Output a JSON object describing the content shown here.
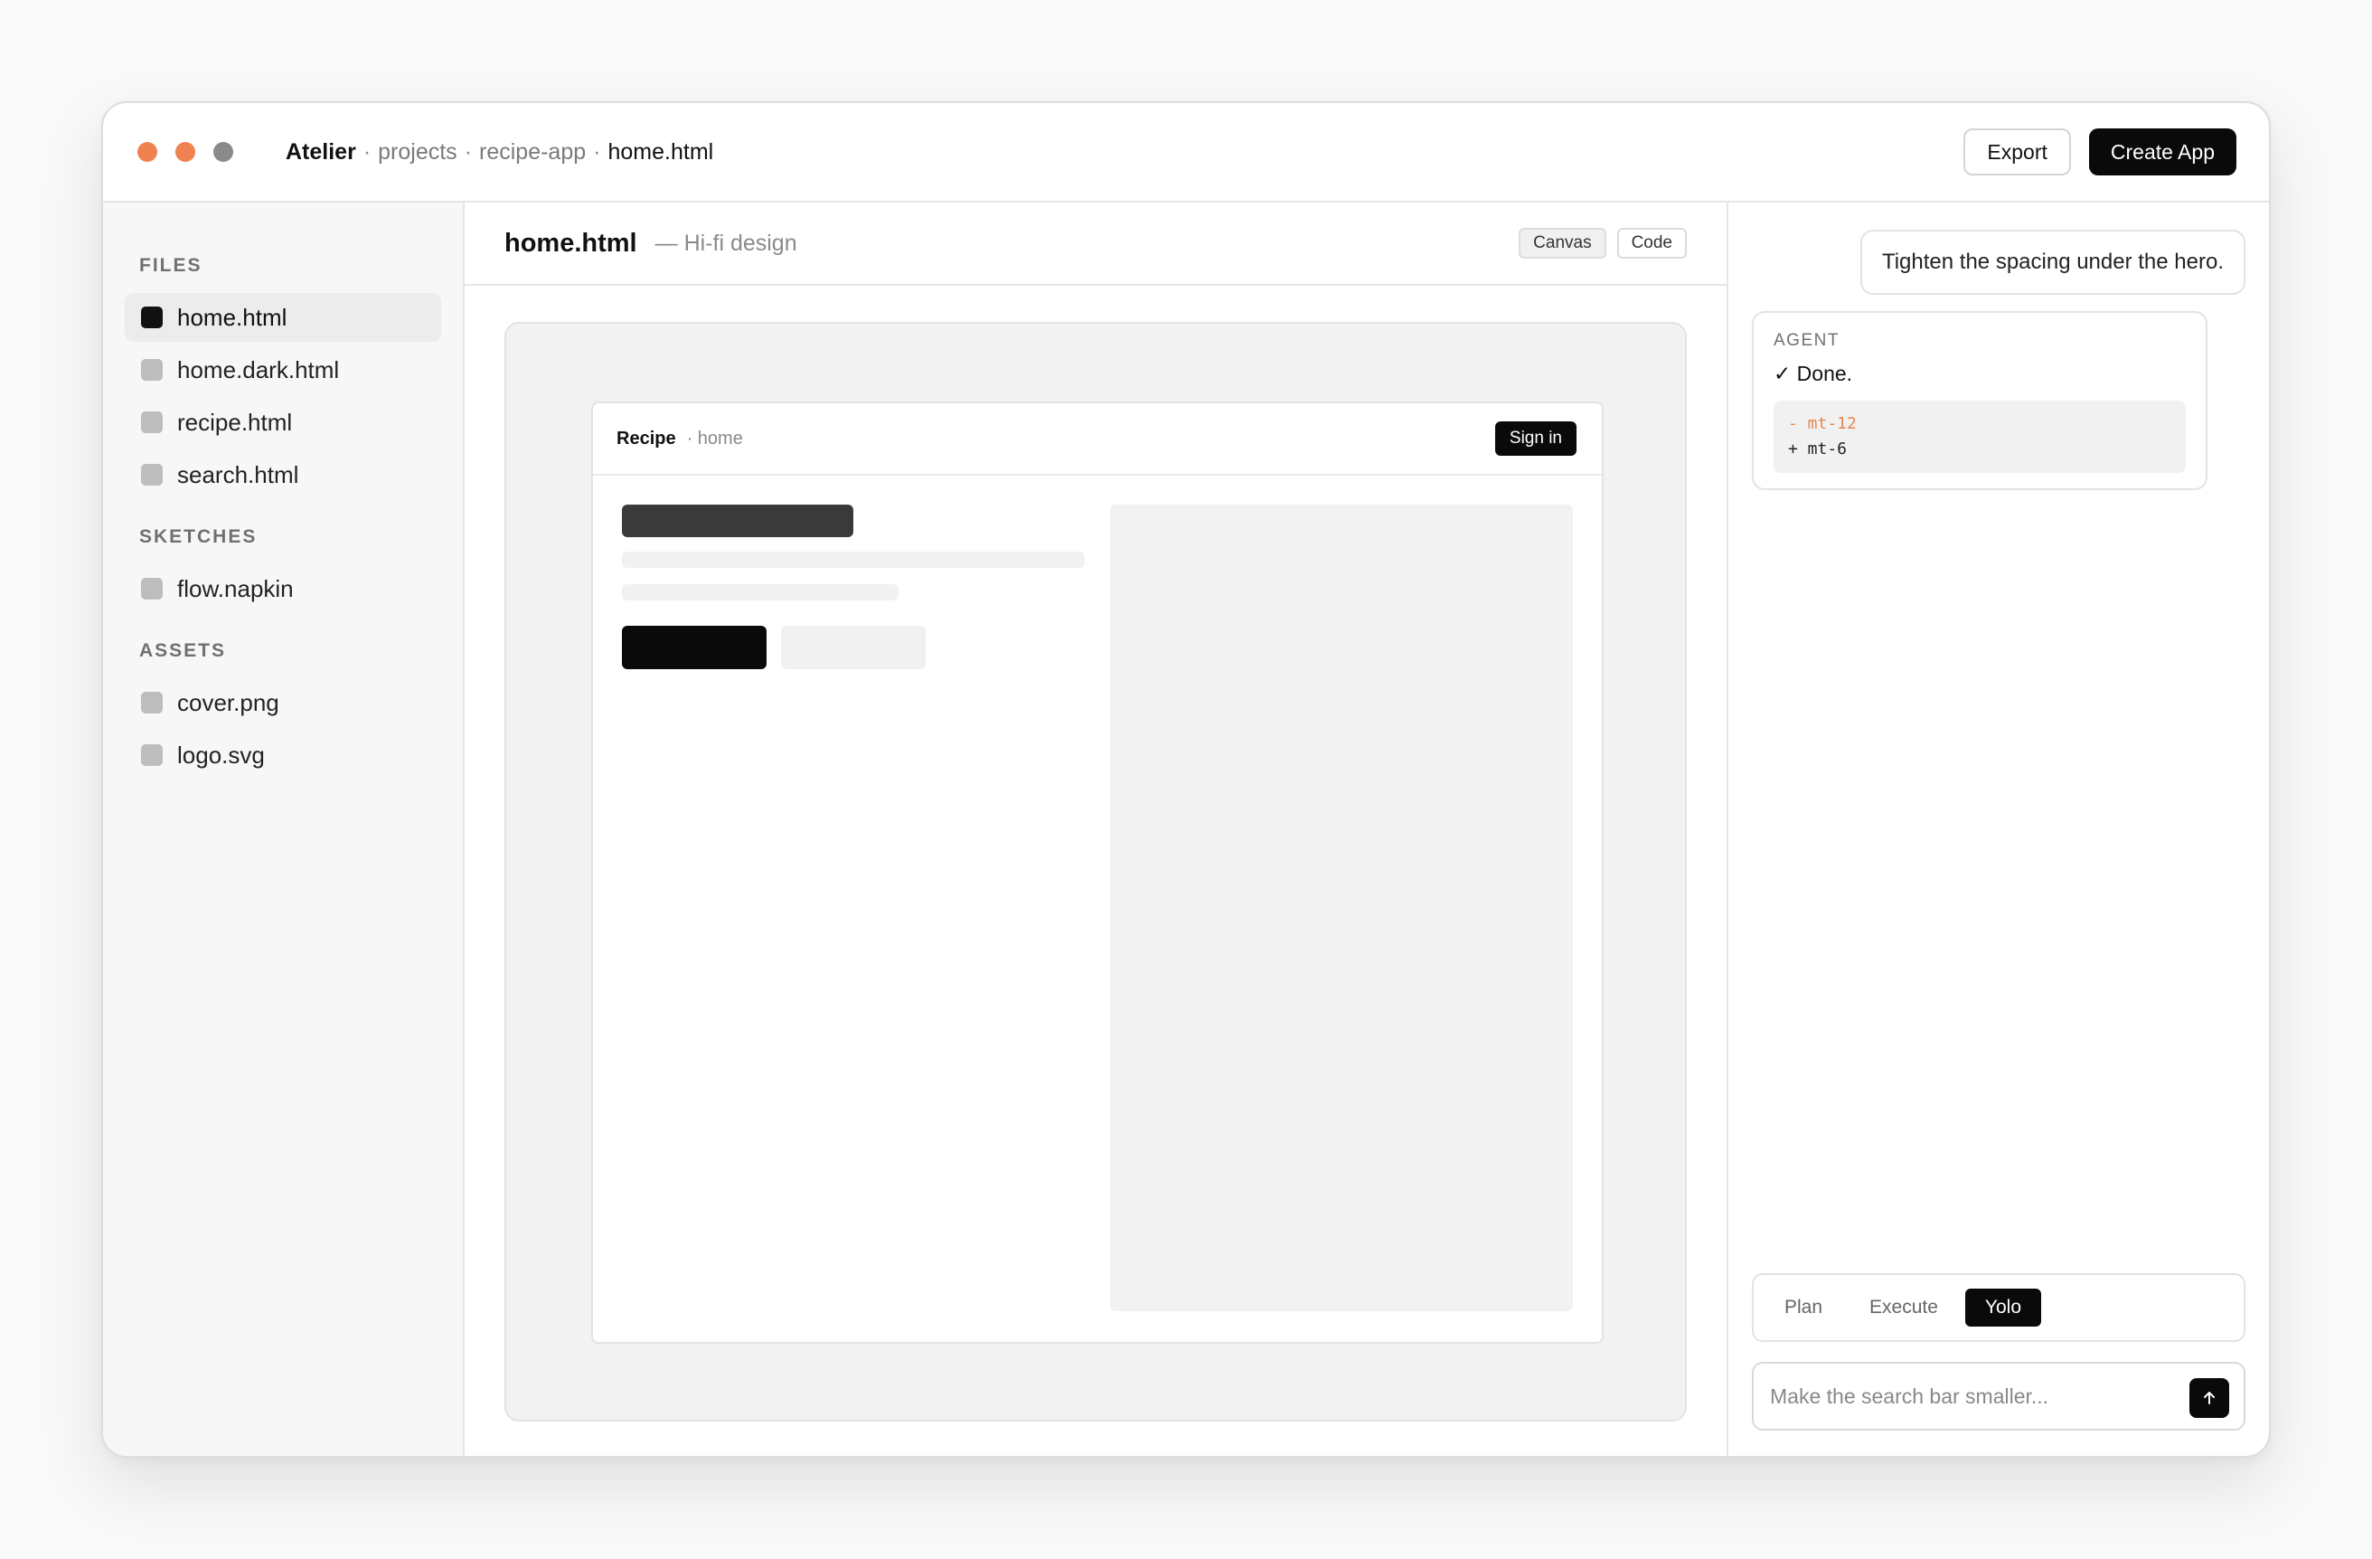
{
  "window": {
    "traffic_colors": [
      "#f0824f",
      "#f0824f",
      "#8a8a8a"
    ]
  },
  "titlebar": {
    "brand": "Atelier",
    "separator": "·",
    "crumbs": [
      "projects",
      "recipe-app"
    ],
    "current": "home.html",
    "export_label": "Export",
    "create_label": "Create App"
  },
  "sidebar": {
    "sections": [
      {
        "label": "FILES",
        "items": [
          {
            "name": "home.html",
            "active": true
          },
          {
            "name": "home.dark.html",
            "active": false
          },
          {
            "name": "recipe.html",
            "active": false
          },
          {
            "name": "search.html",
            "active": false
          }
        ]
      },
      {
        "label": "SKETCHES",
        "items": [
          {
            "name": "flow.napkin",
            "active": false
          }
        ]
      },
      {
        "label": "ASSETS",
        "items": [
          {
            "name": "cover.png",
            "active": false
          },
          {
            "name": "logo.svg",
            "active": false
          }
        ]
      }
    ]
  },
  "editor": {
    "title": "home.html",
    "subtitle": "— Hi-fi design",
    "canvas_label": "Canvas",
    "code_label": "Code",
    "preview": {
      "brand": "Recipe",
      "sub": "· home",
      "signin_label": "Sign in"
    }
  },
  "chat": {
    "user_message": "Tighten the spacing under the hero.",
    "agent_label": "AGENT",
    "agent_status": "✓ Done.",
    "diff_removed": "- mt-12",
    "diff_added": "+ mt-6",
    "modes": [
      "Plan",
      "Execute",
      "Yolo"
    ],
    "active_mode": "Yolo",
    "input_placeholder": "Make the search bar smaller...",
    "send_icon": "arrow-up-icon"
  },
  "colors": {
    "accent_dark": "#0a0a0a",
    "diff_removed": "#e8864f"
  }
}
